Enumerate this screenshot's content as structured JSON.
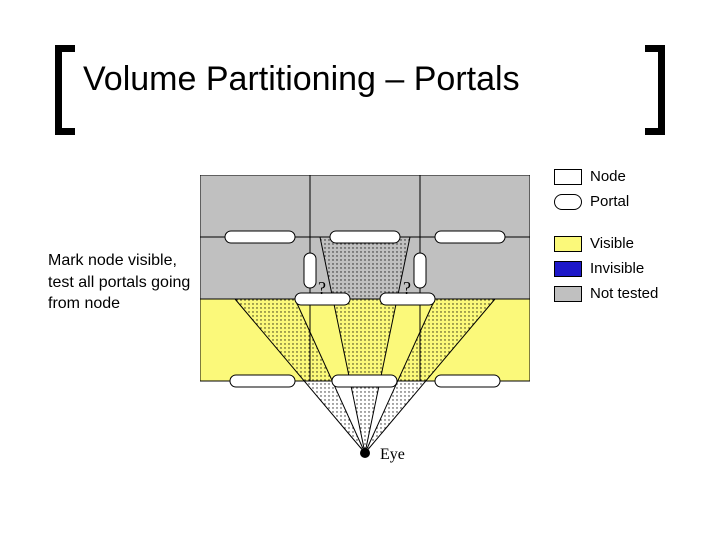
{
  "title": "Volume Partitioning – Portals",
  "caption": "Mark node visible, test all portals going from node",
  "legend": {
    "node": {
      "label": "Node",
      "color": "#ffffff"
    },
    "portal": {
      "label": "Portal",
      "color": "#ffffff"
    },
    "visible": {
      "label": "Visible",
      "color": "#fbf97a"
    },
    "invisible": {
      "label": "Invisible",
      "color": "#1d18c9"
    },
    "nottested": {
      "label": "Not tested",
      "color": "#c0c0c0"
    }
  },
  "labels": {
    "q1": "?",
    "q2": "?",
    "eye": "Eye"
  },
  "colors": {
    "gray": "#c0c0c0",
    "yellow": "#fbf97a",
    "black": "#000000",
    "white": "#ffffff"
  }
}
